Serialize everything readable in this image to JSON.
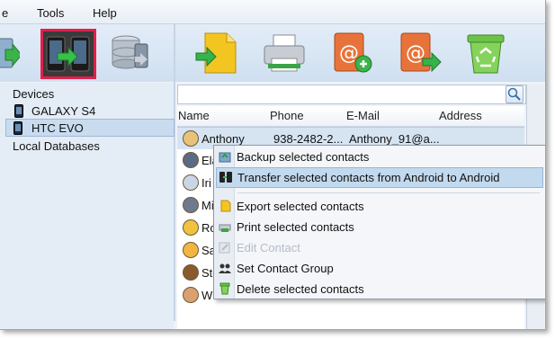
{
  "menubar": {
    "items": [
      {
        "label": "e"
      },
      {
        "label": "Tools"
      },
      {
        "label": "Help"
      }
    ]
  },
  "toolbar": {
    "buttons": [
      {
        "icon": "import-arrow-icon"
      },
      {
        "icon": "phone-transfer-icon",
        "selected": true
      },
      {
        "icon": "database-icon"
      },
      {
        "icon": "import-document-icon"
      },
      {
        "icon": "printer-icon"
      },
      {
        "icon": "add-contact-book-icon"
      },
      {
        "icon": "export-contact-book-icon"
      },
      {
        "icon": "recycle-bin-icon"
      }
    ]
  },
  "tree": {
    "devices_label": "Devices",
    "devices": [
      {
        "label": "GALAXY S4"
      },
      {
        "label": "HTC EVO",
        "selected": true
      }
    ],
    "local_label": "Local Databases"
  },
  "table": {
    "columns": [
      "Name",
      "Phone",
      "E-Mail",
      "Address"
    ],
    "rows": [
      {
        "name": "Anthony",
        "phone": "938-2482-2...",
        "email": "Anthony_91@a...",
        "selected": true
      },
      {
        "name": "Ela",
        "phone": "",
        "email": ""
      },
      {
        "name": "Iri",
        "phone": "",
        "email": ""
      },
      {
        "name": "Mi",
        "phone": "",
        "email": ""
      },
      {
        "name": "Ro",
        "phone": "",
        "email": ""
      },
      {
        "name": "Sa",
        "phone": "",
        "email": ""
      },
      {
        "name": "Ste",
        "phone": "",
        "email": ""
      },
      {
        "name": "Wi",
        "phone": "",
        "email": ""
      }
    ]
  },
  "context_menu": {
    "items": [
      {
        "label": "Backup selected contacts",
        "icon": "backup-icon"
      },
      {
        "label": "Transfer selected contacts from Android to Android",
        "icon": "phone-transfer-icon",
        "highlighted": true
      },
      {
        "label": "Export selected contacts",
        "icon": "export-icon"
      },
      {
        "label": "Print selected contacts",
        "icon": "printer-icon"
      },
      {
        "label": "Edit Contact",
        "icon": "edit-icon",
        "disabled": true
      },
      {
        "label": "Set Contact Group",
        "icon": "group-icon"
      },
      {
        "label": "Delete selected contacts",
        "icon": "delete-icon"
      }
    ]
  },
  "colors": {
    "accent_selection": "#c2d9ee",
    "toolbar_highlight": "#e0204b"
  }
}
